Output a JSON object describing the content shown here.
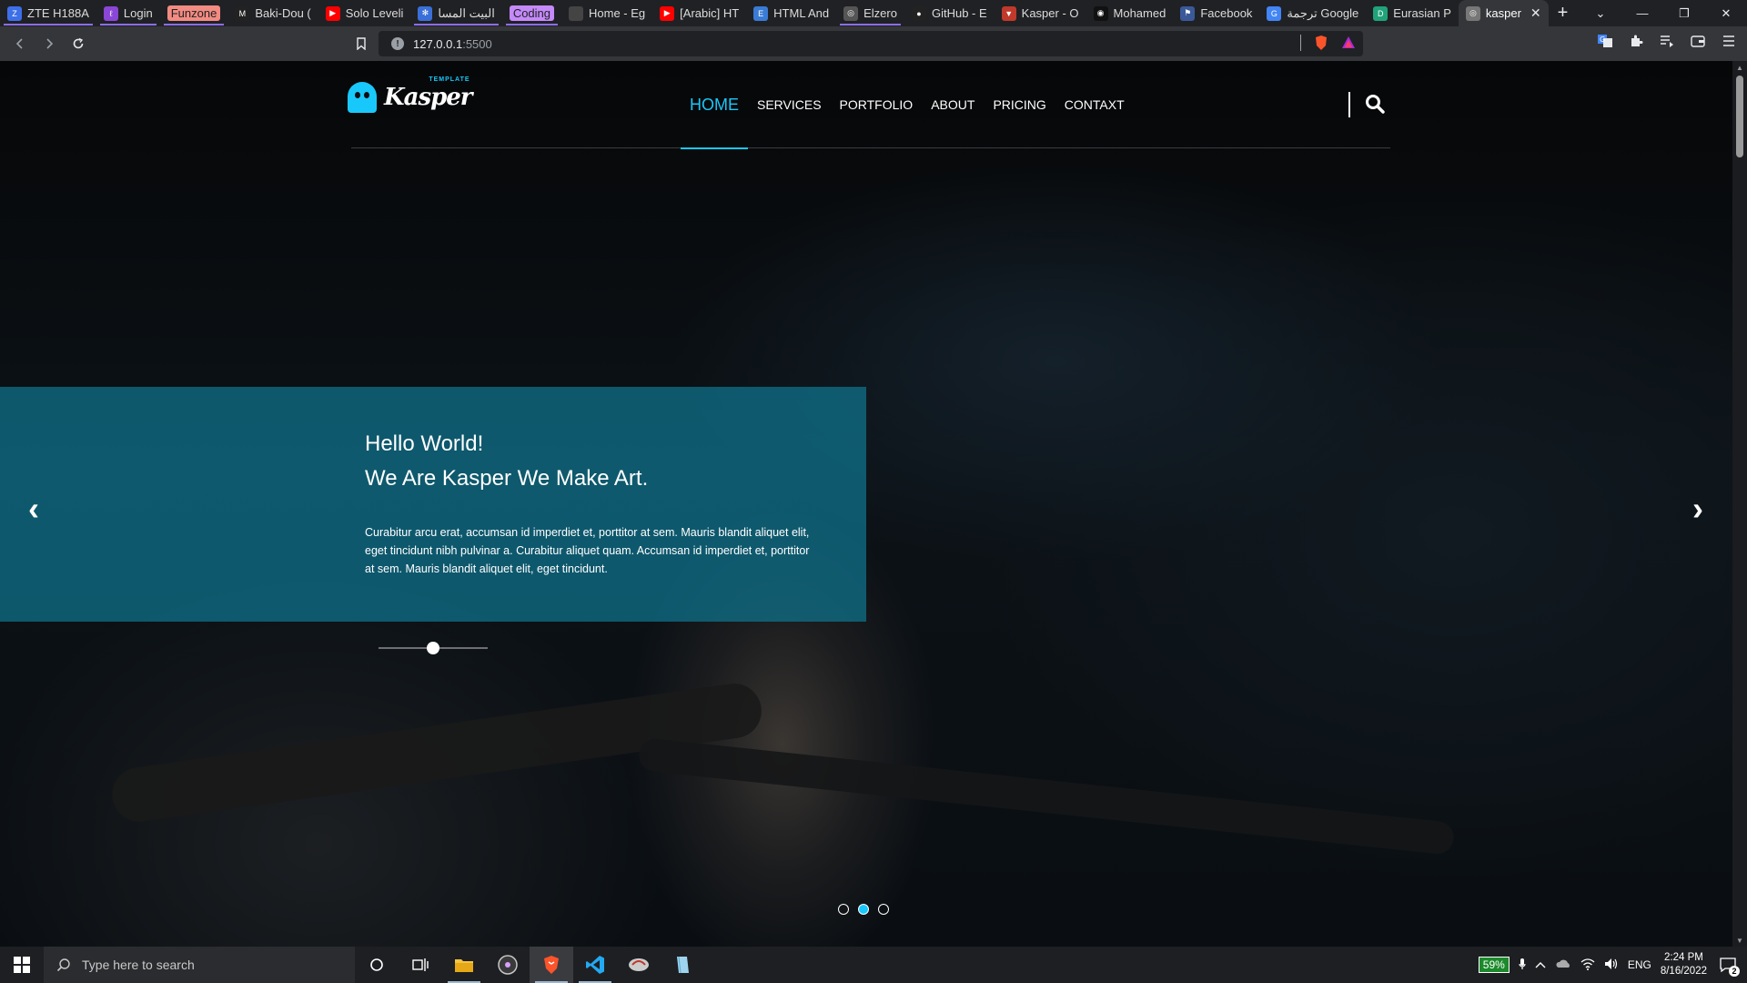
{
  "browser": {
    "tabs": [
      {
        "label": "ZTE  H188A",
        "favicon": "Z",
        "favicon_color": "#3d6fe8",
        "underline": "#8b6df0"
      },
      {
        "label": "Login",
        "favicon": "ℓ",
        "favicon_color": "#8a46d6",
        "underline": "#8b6df0"
      },
      {
        "label": "Funzone",
        "favicon": "",
        "favicon_color": "#f28b82",
        "underline": "#8b6df0",
        "chip": true
      },
      {
        "label": "Baki-Dou (",
        "favicon": "M",
        "favicon_color": "#222",
        "underline": ""
      },
      {
        "label": "Solo Leveli",
        "favicon": "▶",
        "favicon_color": "#ff0000",
        "underline": ""
      },
      {
        "label": "البيت المسا",
        "favicon": "✻",
        "favicon_color": "#3a6fd8",
        "underline": "#8b6df0"
      },
      {
        "label": "Coding",
        "favicon": "",
        "favicon_color": "#c58af9",
        "underline": "#8b6df0",
        "chip": true
      },
      {
        "label": "Home - Eg",
        "favicon": "",
        "favicon_color": "#444",
        "underline": ""
      },
      {
        "label": "[Arabic] HT",
        "favicon": "▶",
        "favicon_color": "#ff0000",
        "underline": ""
      },
      {
        "label": "HTML And",
        "favicon": "E",
        "favicon_color": "#3a7bd5",
        "underline": ""
      },
      {
        "label": "Elzero",
        "favicon": "◎",
        "favicon_color": "#555",
        "underline": "#8b6df0"
      },
      {
        "label": "GitHub - E",
        "favicon": "●",
        "favicon_color": "#222",
        "underline": ""
      },
      {
        "label": "Kasper - O",
        "favicon": "▼",
        "favicon_color": "#c0392b",
        "underline": ""
      },
      {
        "label": "Mohamed",
        "favicon": "◉",
        "favicon_color": "#111",
        "underline": ""
      },
      {
        "label": "Facebook",
        "favicon": "⚑",
        "favicon_color": "#3b5998",
        "underline": ""
      },
      {
        "label": "ترجمة Google",
        "favicon": "G",
        "favicon_color": "#4285f4",
        "underline": ""
      },
      {
        "label": "Eurasian P",
        "favicon": "D",
        "favicon_color": "#20a37a",
        "underline": ""
      },
      {
        "label": "kasper",
        "favicon": "◎",
        "favicon_color": "#777",
        "underline": "",
        "active": true
      }
    ],
    "new_tab": "+",
    "window_controls": {
      "list": "⌄",
      "minimize": "—",
      "restore": "❐",
      "close": "✕"
    },
    "url_host": "127.0.0.1",
    "url_port": ":5500"
  },
  "page": {
    "logo_text": "Kasper",
    "logo_sub": "TEMPLATE",
    "nav": {
      "home": "HOME",
      "services": "SERVICES",
      "portfolio": "PORTFOLIO",
      "about": "ABOUT",
      "pricing": "PRICING",
      "contact": "CONTAXT"
    },
    "slide": {
      "title1": "Hello World!",
      "title2": "We Are Kasper We Make Art.",
      "text": "Curabitur arcu erat, accumsan id imperdiet et, porttitor at sem. Mauris blandit aliquet elit, eget tincidunt nibh pulvinar a. Curabitur aliquet quam. Accumsan id imperdiet et, porttitor at sem. Mauris blandit aliquet elit, eget tincidunt.",
      "prev": "‹",
      "next": "›",
      "progress": 0.5,
      "active_dot": 2,
      "dot_count": 3
    },
    "accent_color": "#19c8fa"
  },
  "taskbar": {
    "search_placeholder": "Type here to search",
    "battery": "59%",
    "language": "ENG",
    "time": "2:24 PM",
    "date": "8/16/2022",
    "notifications": "2"
  }
}
